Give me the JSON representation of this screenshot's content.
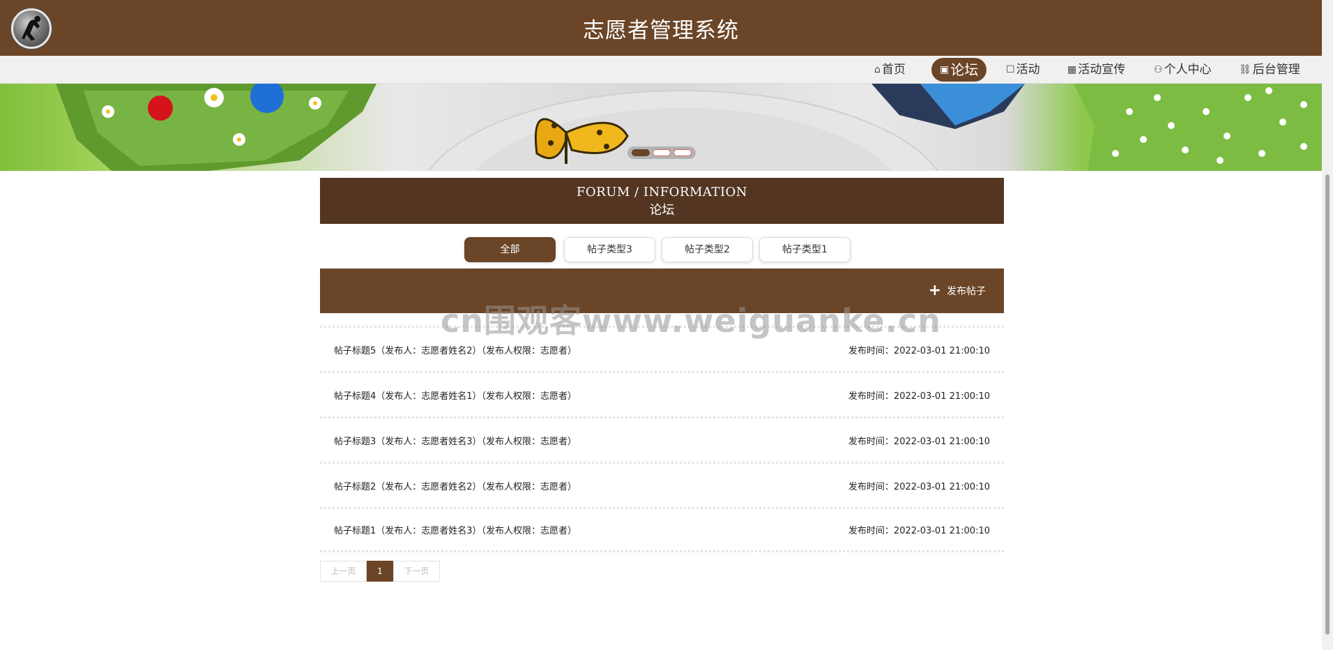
{
  "header": {
    "title": "志愿者管理系统"
  },
  "nav": {
    "items": [
      {
        "icon": "⌂",
        "label": "首页"
      },
      {
        "icon": "▣",
        "label": "论坛"
      },
      {
        "icon": "☐",
        "label": "活动"
      },
      {
        "icon": "▦",
        "label": "活动宣传"
      },
      {
        "icon": "⚇",
        "label": "个人中心"
      },
      {
        "icon": "⛓",
        "label": "后台管理"
      }
    ],
    "active_index": 1
  },
  "section": {
    "title_en": "FORUM / INFORMATION",
    "title_cn": "论坛"
  },
  "tabs": [
    {
      "label": "全部",
      "active": true
    },
    {
      "label": "帖子类型3",
      "active": false
    },
    {
      "label": "帖子类型2",
      "active": false
    },
    {
      "label": "帖子类型1",
      "active": false
    }
  ],
  "toolbar": {
    "post_label": "发布帖子"
  },
  "watermark": "cn围观客www.weiguanke.cn",
  "posts": [
    {
      "title": "帖子标题5（发布人：志愿者姓名2）（发布人权限：志愿者）",
      "time": "发布时间：2022-03-01 21:00:10"
    },
    {
      "title": "帖子标题4（发布人：志愿者姓名1）（发布人权限：志愿者）",
      "time": "发布时间：2022-03-01 21:00:10"
    },
    {
      "title": "帖子标题3（发布人：志愿者姓名3）（发布人权限：志愿者）",
      "time": "发布时间：2022-03-01 21:00:10"
    },
    {
      "title": "帖子标题2（发布人：志愿者姓名2）（发布人权限：志愿者）",
      "time": "发布时间：2022-03-01 21:00:10"
    },
    {
      "title": "帖子标题1（发布人：志愿者姓名3）（发布人权限：志愿者）",
      "time": "发布时间：2022-03-01 21:00:10"
    }
  ],
  "pager": {
    "prev": "上一页",
    "current": "1",
    "next": "下一页"
  },
  "colors": {
    "primary": "#6b4527",
    "section_head": "#533522",
    "nav_bg": "#f0f0f0"
  }
}
